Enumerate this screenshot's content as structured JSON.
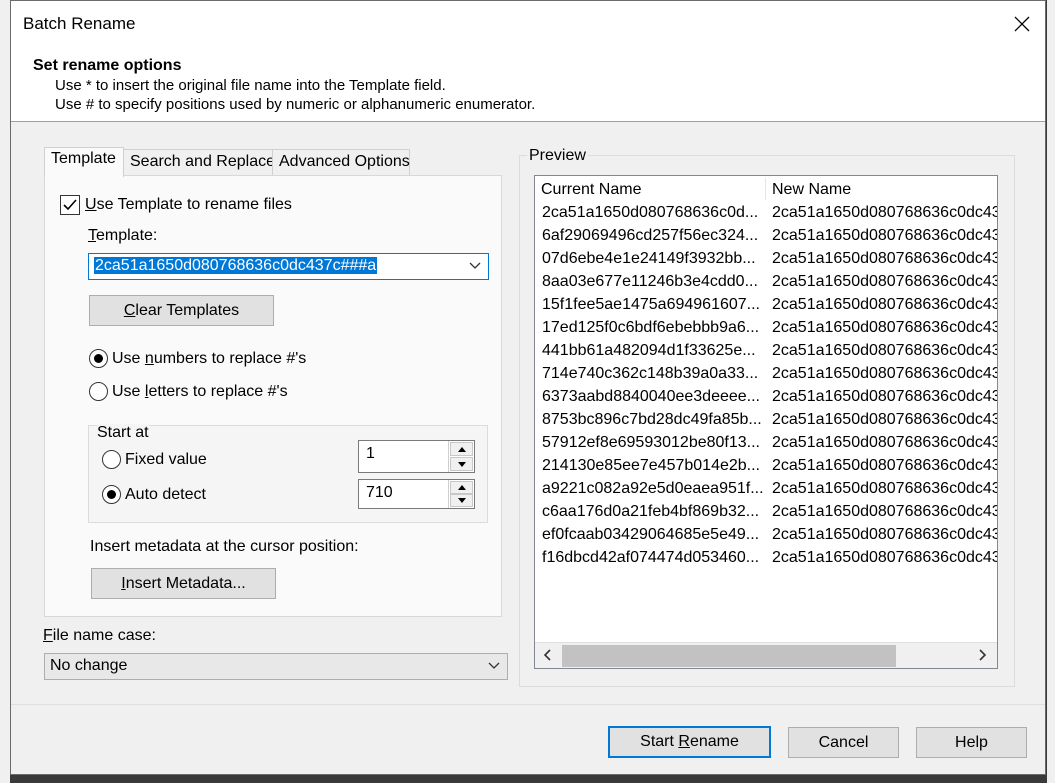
{
  "window": {
    "title": "Batch Rename"
  },
  "header": {
    "title": "Set rename options",
    "line1": "Use * to insert the original file name into the Template field.",
    "line2": "Use # to specify positions used by numeric or alphanumeric enumerator."
  },
  "tabs": [
    {
      "label": "Template",
      "active": true
    },
    {
      "label": "Search and Replace",
      "active": false
    },
    {
      "label": "Advanced Options",
      "active": false
    }
  ],
  "template_tab": {
    "use_template_label_u": "U",
    "use_template_label_rest": "se Template to rename files",
    "use_template_checked": true,
    "template_label_u": "T",
    "template_label_rest": "emplate:",
    "template_value": "2ca51a1650d080768636c0dc437c###a",
    "clear_templates_u": "C",
    "clear_templates_rest": "lear Templates",
    "numbers_pre": "Use ",
    "numbers_u": "n",
    "numbers_rest": "umbers to replace #'s",
    "numbers_selected": true,
    "letters_pre": "Use ",
    "letters_u": "l",
    "letters_rest": "etters to replace #'s",
    "start_at": {
      "title": "Start at",
      "fixed_label": "Fixed value",
      "fixed_value": "1",
      "auto_label": "Auto detect",
      "auto_value": "710",
      "auto_selected": true
    },
    "metadata_label": "Insert metadata at the cursor position:",
    "insert_metadata_u": "I",
    "insert_metadata_rest": "nsert Metadata..."
  },
  "file_case": {
    "label_u": "F",
    "label_rest": "ile name case:",
    "value": "No change"
  },
  "preview": {
    "title": "Preview",
    "col_current": "Current Name",
    "col_new": "New Name",
    "rows": [
      {
        "current": "2ca51a1650d080768636c0d...",
        "new": "2ca51a1650d080768636c0dc43"
      },
      {
        "current": "6af29069496cd257f56ec324...",
        "new": "2ca51a1650d080768636c0dc43"
      },
      {
        "current": "07d6ebe4e1e24149f3932bb...",
        "new": "2ca51a1650d080768636c0dc43"
      },
      {
        "current": "8aa03e677e11246b3e4cdd0...",
        "new": "2ca51a1650d080768636c0dc43"
      },
      {
        "current": "15f1fee5ae1475a694961607...",
        "new": "2ca51a1650d080768636c0dc43"
      },
      {
        "current": "17ed125f0c6bdf6ebebbb9a6...",
        "new": "2ca51a1650d080768636c0dc43"
      },
      {
        "current": "441bb61a482094d1f33625e...",
        "new": "2ca51a1650d080768636c0dc43"
      },
      {
        "current": "714e740c362c148b39a0a33...",
        "new": "2ca51a1650d080768636c0dc43"
      },
      {
        "current": "6373aabd8840040ee3deeee...",
        "new": "2ca51a1650d080768636c0dc43"
      },
      {
        "current": "8753bc896c7bd28dc49fa85b...",
        "new": "2ca51a1650d080768636c0dc43"
      },
      {
        "current": "57912ef8e69593012be80f13...",
        "new": "2ca51a1650d080768636c0dc43"
      },
      {
        "current": "214130e85ee7e457b014e2b...",
        "new": "2ca51a1650d080768636c0dc43"
      },
      {
        "current": "a9221c082a92e5d0eaea951f...",
        "new": "2ca51a1650d080768636c0dc43"
      },
      {
        "current": "c6aa176d0a21feb4bf869b32...",
        "new": "2ca51a1650d080768636c0dc43"
      },
      {
        "current": "ef0fcaab03429064685e5e49...",
        "new": "2ca51a1650d080768636c0dc43"
      },
      {
        "current": "f16dbcd42af074474d053460...",
        "new": "2ca51a1650d080768636c0dc43"
      }
    ]
  },
  "buttons": {
    "start_pre": "Start ",
    "start_u": "R",
    "start_rest": "ename",
    "cancel": "Cancel",
    "help": "Help"
  },
  "colors": {
    "accent": "#0078d7",
    "dialog_bg": "#f0f0f0",
    "backdrop": "#3a3a3a"
  }
}
